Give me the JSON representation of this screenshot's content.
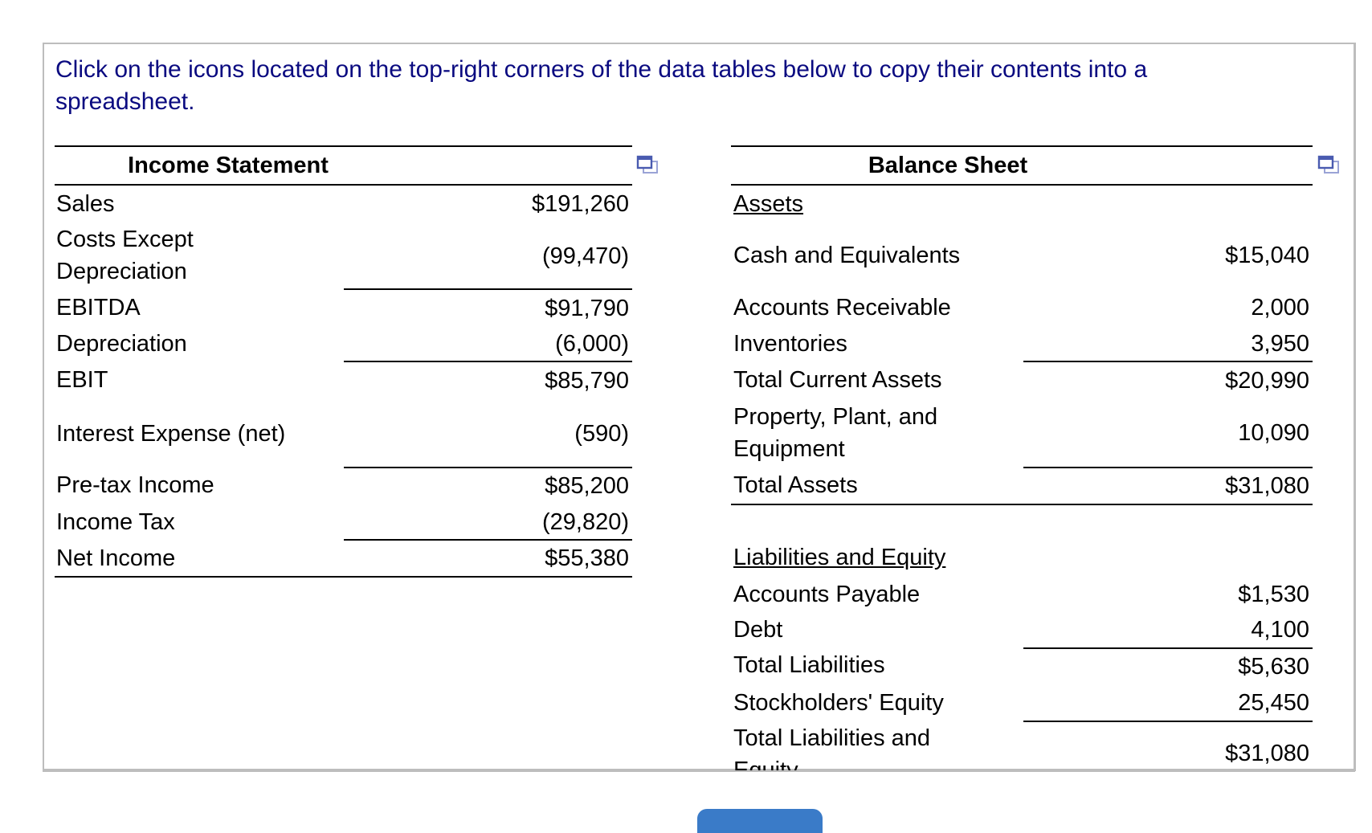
{
  "instruction": {
    "line1": "Click on the icons located on the top-right corners of the data tables below to copy their contents into a",
    "line2": "spreadsheet."
  },
  "colors": {
    "instruction_text": "#0a0a80",
    "copy_icon": "#4a5bb0",
    "button": "#3a7bc8",
    "panel_border": "#bdbdbd"
  },
  "income_statement": {
    "title": "Income Statement",
    "copy_icon": "copy-to-spreadsheet-icon",
    "rows": [
      {
        "label": "Sales",
        "value": "$191,260"
      },
      {
        "label": "Costs Except",
        "label2": "Depreciation",
        "value": "(99,470)"
      },
      {
        "label": "EBITDA",
        "value": "$91,790"
      },
      {
        "label": "Depreciation",
        "value": "(6,000)"
      },
      {
        "label": "EBIT",
        "value": "$85,790"
      },
      {
        "label": "Interest Expense (net)",
        "value": "(590)"
      },
      {
        "label": "Pre-tax Income",
        "value": "$85,200"
      },
      {
        "label": "Income Tax",
        "value": "(29,820)"
      },
      {
        "label": "Net Income",
        "value": "$55,380"
      }
    ]
  },
  "balance_sheet": {
    "title": "Balance Sheet",
    "copy_icon": "copy-to-spreadsheet-icon",
    "assets_heading": "Assets",
    "assets": [
      {
        "label": "Cash and Equivalents",
        "value": "$15,040"
      },
      {
        "label": "Accounts Receivable",
        "value": "2,000"
      },
      {
        "label": "Inventories",
        "value": "3,950"
      },
      {
        "label": "Total Current Assets",
        "value": "$20,990"
      },
      {
        "label": "Property, Plant, and",
        "label2": "Equipment",
        "value": "10,090"
      },
      {
        "label": "Total Assets",
        "value": "$31,080"
      }
    ],
    "liabilities_heading": "Liabilities and Equity",
    "liabilities": [
      {
        "label": "Accounts Payable",
        "value": "$1,530"
      },
      {
        "label": "Debt",
        "value": "4,100"
      },
      {
        "label": "Total Liabilities",
        "value": "$5,630"
      },
      {
        "label": "Stockholders' Equity",
        "value": "25,450"
      },
      {
        "label": "Total Liabilities and",
        "label2": "Equity",
        "value": "$31,080"
      }
    ]
  }
}
